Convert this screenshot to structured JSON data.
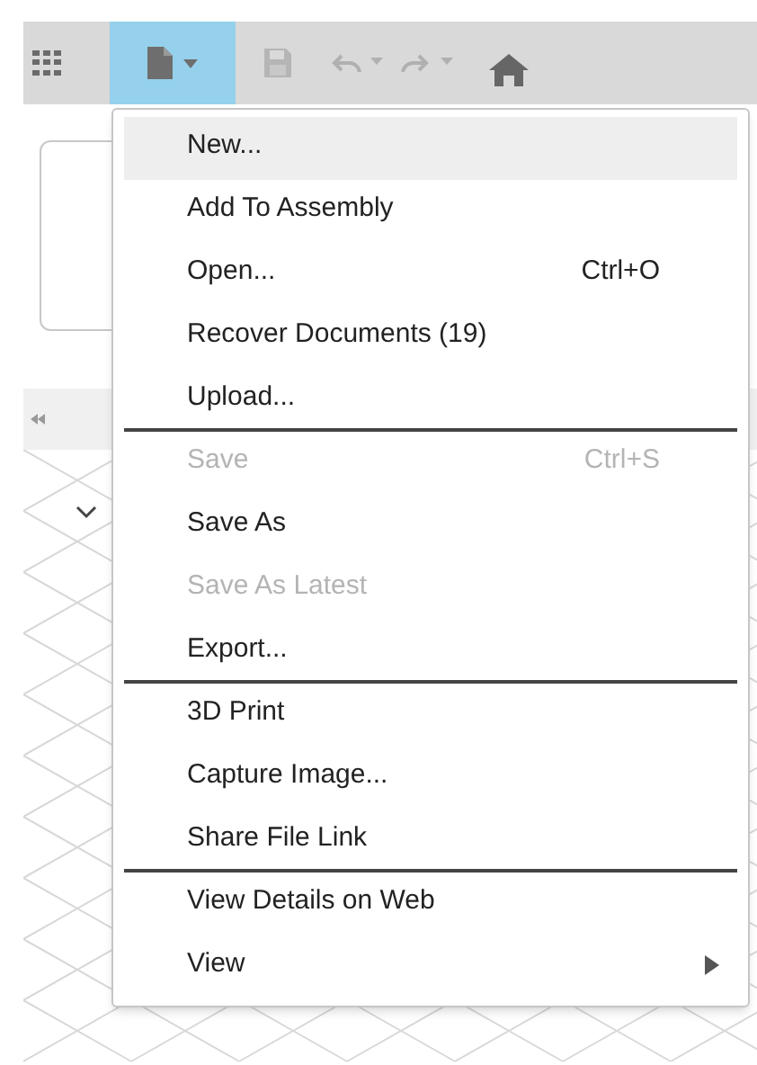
{
  "toolbar": {
    "file_button": {
      "selected": true
    }
  },
  "file_menu": {
    "items": [
      {
        "label": "New...",
        "selected": true,
        "disabled": false,
        "divider_after": false
      },
      {
        "label": "Add To Assembly",
        "selected": false,
        "disabled": false,
        "divider_after": false
      },
      {
        "label": "Open...",
        "shortcut": "Ctrl+O",
        "selected": false,
        "disabled": false,
        "divider_after": false
      },
      {
        "label": "Recover Documents (19)",
        "selected": false,
        "disabled": false,
        "divider_after": false
      },
      {
        "label": "Upload...",
        "selected": false,
        "disabled": false,
        "divider_after": true
      },
      {
        "label": "Save",
        "shortcut": "Ctrl+S",
        "selected": false,
        "disabled": true,
        "divider_after": false
      },
      {
        "label": "Save As",
        "selected": false,
        "disabled": false,
        "divider_after": false
      },
      {
        "label": "Save As Latest",
        "selected": false,
        "disabled": true,
        "divider_after": false
      },
      {
        "label": "Export...",
        "selected": false,
        "disabled": false,
        "divider_after": true
      },
      {
        "label": "3D Print",
        "selected": false,
        "disabled": false,
        "divider_after": false
      },
      {
        "label": "Capture Image...",
        "selected": false,
        "disabled": false,
        "divider_after": false
      },
      {
        "label": "Share File Link",
        "selected": false,
        "disabled": false,
        "divider_after": true
      },
      {
        "label": "View Details on Web",
        "selected": false,
        "disabled": false,
        "divider_after": false
      },
      {
        "label": "View",
        "submenu": true,
        "selected": false,
        "disabled": false,
        "divider_after": false
      }
    ]
  }
}
